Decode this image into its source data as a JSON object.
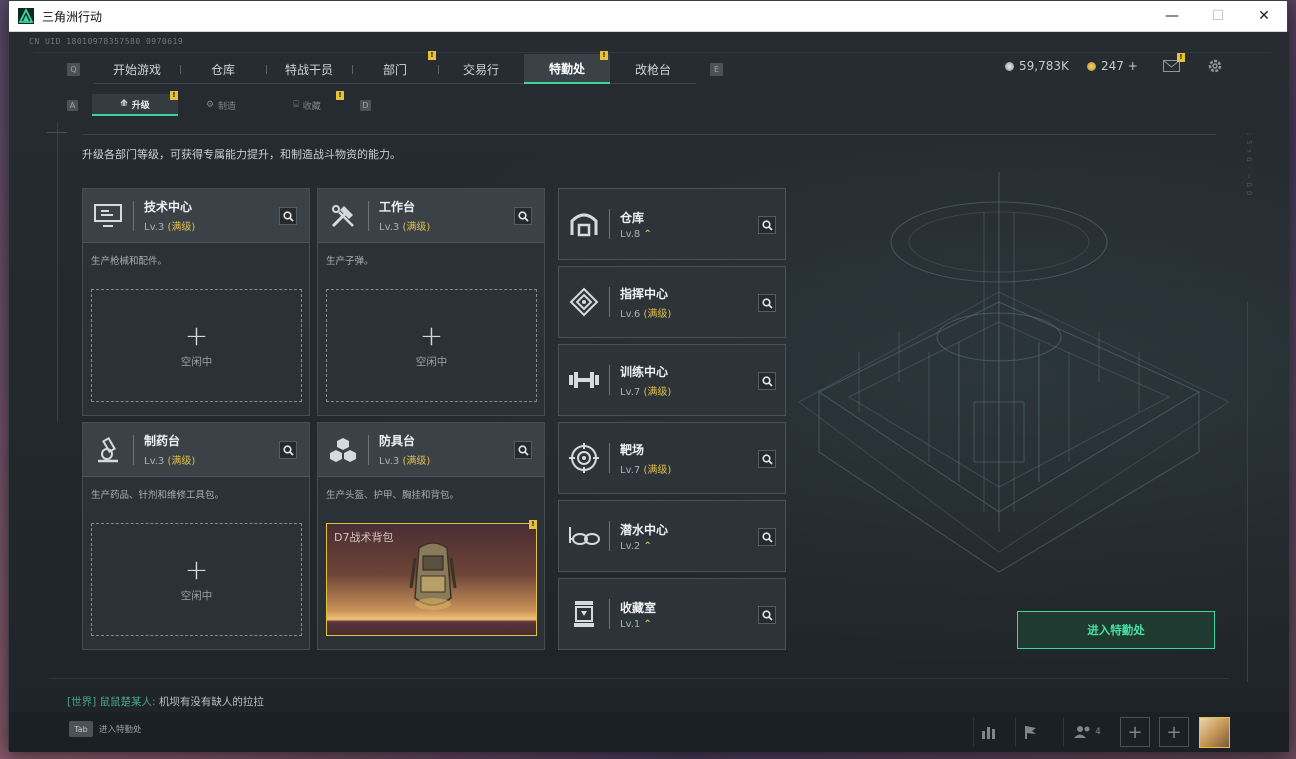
{
  "window": {
    "title": "三角洲行动",
    "minimize": "—",
    "maximize": "☐",
    "close": "✕"
  },
  "uid": "CN UID 18010978357580 0970619",
  "nav": {
    "left_key": "Q",
    "right_key": "E",
    "tabs": [
      {
        "label": "开始游戏"
      },
      {
        "label": "仓库"
      },
      {
        "label": "特战干员"
      },
      {
        "label": "部门",
        "badge": "!"
      },
      {
        "label": "交易行"
      },
      {
        "label": "特勤处",
        "badge": "!",
        "active": true
      },
      {
        "label": "改枪台"
      }
    ]
  },
  "currency": {
    "coins": "59,783K",
    "points": "247 +"
  },
  "mail_badge": "!",
  "subnav": {
    "left_key": "A",
    "right_key": "D",
    "tabs": [
      {
        "label": "升级",
        "active": true,
        "badge": "!"
      },
      {
        "label": "制造"
      },
      {
        "label": "收藏",
        "badge": "!"
      }
    ]
  },
  "description": "升级各部门等级，可获得专属能力提升，和制造战斗物资的能力。",
  "workshops": [
    {
      "name": "技术中心",
      "level": "Lv.3",
      "max": "(满级)",
      "text": "生产枪械和配件。",
      "idle": "空闲中",
      "icon": "monitor-icon"
    },
    {
      "name": "工作台",
      "level": "Lv.3",
      "max": "(满级)",
      "text": "生产子弹。",
      "idle": "空闲中",
      "icon": "tools-icon"
    },
    {
      "name": "制药台",
      "level": "Lv.3",
      "max": "(满级)",
      "text": "生产药品、针剂和维修工具包。",
      "idle": "空闲中",
      "icon": "microscope-icon"
    },
    {
      "name": "防具台",
      "level": "Lv.3",
      "max": "(满级)",
      "text": "生产头盔、护甲、胸挂和背包。",
      "product": "D7战术背包",
      "product_badge": "!",
      "icon": "cubes-icon"
    }
  ],
  "facilities": [
    {
      "name": "仓库",
      "level": "Lv.8",
      "upgrade": "⌃",
      "icon": "warehouse-icon"
    },
    {
      "name": "指挥中心",
      "level": "Lv.6",
      "max": "(满级)",
      "icon": "command-icon"
    },
    {
      "name": "训练中心",
      "level": "Lv.7",
      "max": "(满级)",
      "icon": "dumbbell-icon"
    },
    {
      "name": "靶场",
      "level": "Lv.7",
      "max": "(满级)",
      "icon": "target-icon"
    },
    {
      "name": "潜水中心",
      "level": "Lv.2",
      "upgrade": "⌃",
      "icon": "goggles-icon"
    },
    {
      "name": "收藏室",
      "level": "Lv.1",
      "upgrade": "⌃",
      "icon": "trophy-icon"
    }
  ],
  "enter_button": "进入特勤处",
  "chat": {
    "channel": "[世界]",
    "user": "鼠鼠楚某人:",
    "message": "机坝有没有缺人的拉拉"
  },
  "bottom": {
    "tab_key": "Tab",
    "tab_label": "进入特勤处",
    "team_count": "4"
  },
  "colors": {
    "accent": "#3ed59c",
    "badge": "#e6c13a",
    "max_level": "#e0be4c"
  }
}
